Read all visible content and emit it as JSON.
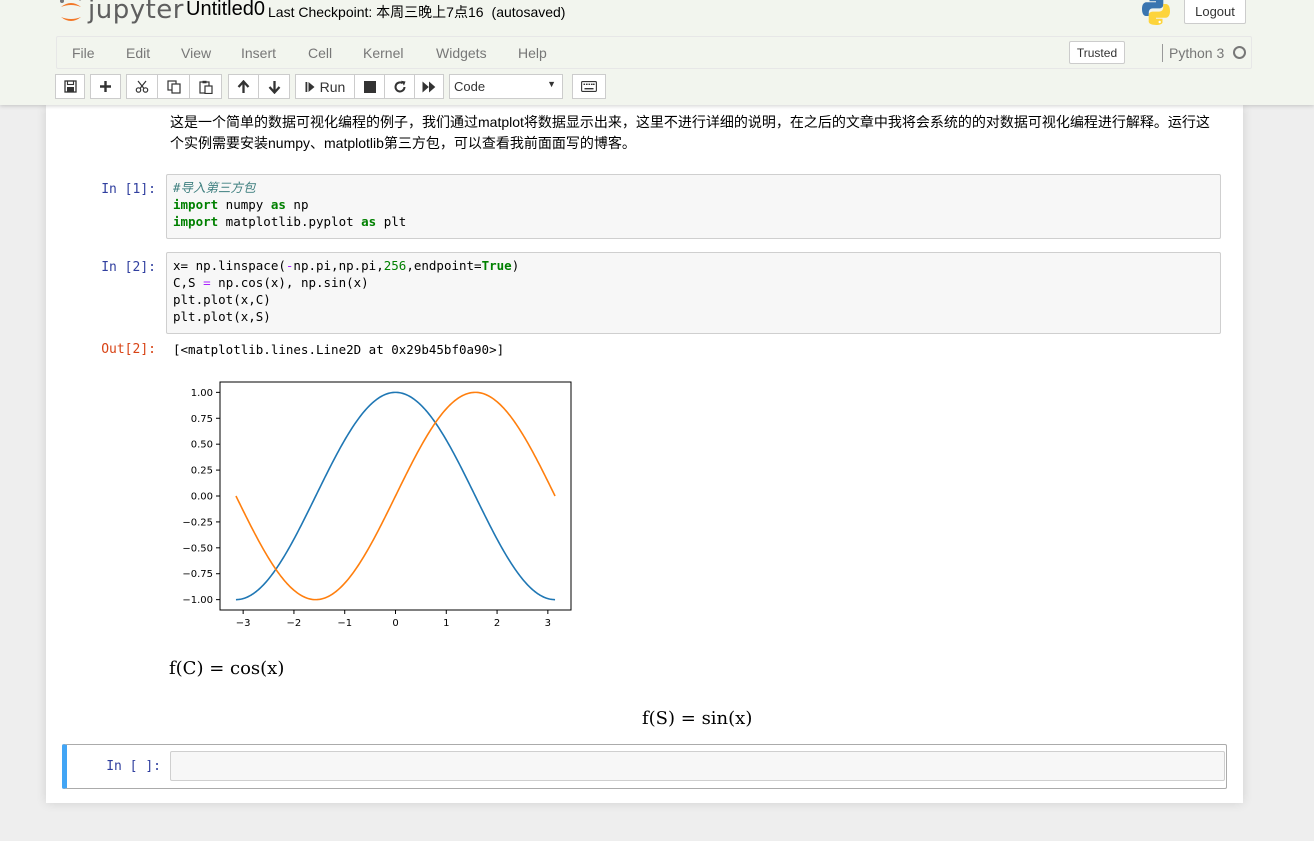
{
  "header": {
    "logo_text": "jupyter",
    "notebook_name": "Untitled0",
    "checkpoint_text": "Last Checkpoint: 本周三晚上7点16",
    "autosave_status": "(autosaved)",
    "logout_label": "Logout"
  },
  "menubar": {
    "items": [
      "File",
      "Edit",
      "View",
      "Insert",
      "Cell",
      "Kernel",
      "Widgets",
      "Help"
    ],
    "trusted_label": "Trusted",
    "kernel_name": "Python 3"
  },
  "toolbar": {
    "run_label": "Run",
    "cell_type": "Code",
    "icons": [
      "save-icon",
      "plus-icon",
      "cut-icon",
      "copy-icon",
      "paste-icon",
      "arrow-up-icon",
      "arrow-down-icon",
      "step-forward-icon",
      "stop-icon",
      "restart-icon",
      "fast-forward-icon",
      "keyboard-icon"
    ]
  },
  "notebook": {
    "markdown_text": "这是一个简单的数据可视化编程的例子，我们通过matplot将数据显示出来，这里不进行详细的说明，在之后的文章中我将会系统的的对数据可视化编程进行解释。运行这个实例需要安装numpy、matplotlib第三方包，可以查看我前面面写的博客。",
    "cells": [
      {
        "prompt": "In [1]:",
        "lines": [
          "#导入第三方包",
          "import numpy as np",
          "import matplotlib.pyplot as plt"
        ]
      },
      {
        "prompt": "In [2]:",
        "lines": [
          "x= np.linspace(-np.pi,np.pi,256,endpoint=True)",
          "C,S = np.cos(x), np.sin(x)",
          "plt.plot(x,C)",
          "plt.plot(x,S)"
        ]
      }
    ],
    "output_prompt": "Out[2]:",
    "output_text": "[<matplotlib.lines.Line2D at 0x29b45bf0a90>]",
    "equation1": "f(C) = cos(x)",
    "equation2": "f(S) = sin(x)",
    "empty_cell_prompt": "In [ ]:"
  },
  "chart_data": {
    "type": "line",
    "title": "",
    "xlabel": "",
    "ylabel": "",
    "xlim": [
      -3.4558,
      3.4558
    ],
    "ylim": [
      -1.1,
      1.1
    ],
    "grid": false,
    "xticks": [
      -3,
      -2,
      -1,
      0,
      1,
      2,
      3
    ],
    "xtick_labels": [
      "−3",
      "−2",
      "−1",
      "0",
      "1",
      "2",
      "3"
    ],
    "yticks": [
      -1.0,
      -0.75,
      -0.5,
      -0.25,
      0.0,
      0.25,
      0.5,
      0.75,
      1.0
    ],
    "ytick_labels": [
      "−1.00",
      "−0.75",
      "−0.50",
      "−0.25",
      "0.00",
      "0.25",
      "0.50",
      "0.75",
      "1.00"
    ],
    "series": [
      {
        "function": "cos",
        "color": "#1f77b4",
        "x_range": [
          -3.14159,
          3.14159
        ],
        "samples": 256
      },
      {
        "function": "sin",
        "color": "#ff7f0e",
        "x_range": [
          -3.14159,
          3.14159
        ],
        "samples": 256
      }
    ]
  }
}
